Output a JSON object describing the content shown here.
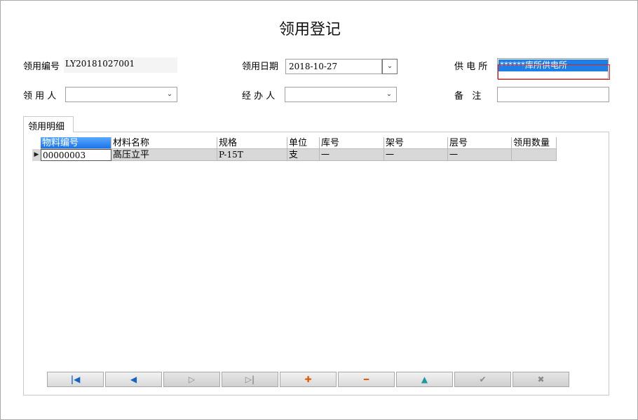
{
  "window": {
    "title": "领用登记"
  },
  "form": {
    "requisition_no_label": "领用编号",
    "requisition_no_value": "LY20181027001",
    "requisition_date_label": "领用日期",
    "requisition_date_value": "2018-10-27",
    "supply_station_label": "供 电 所",
    "supply_station_value": "******库所供电所",
    "requester_label": "领 用 人",
    "requester_value": "",
    "handler_label": "经 办 人",
    "handler_value": "",
    "remarks_label": "备   注",
    "remarks_value": ""
  },
  "tab": {
    "label": "领用明细"
  },
  "grid": {
    "columns": [
      "物料编号",
      "材料名称",
      "规格",
      "单位",
      "库号",
      "架号",
      "层号",
      "领用数量"
    ],
    "rows": [
      [
        "00000003",
        "高压立平",
        "P-15T",
        "支",
        "一",
        "一",
        "一",
        ""
      ]
    ]
  },
  "navigator": {
    "buttons": [
      {
        "name": "first-record-button",
        "glyph": "|◀",
        "color": "#1565c0",
        "enabled": true
      },
      {
        "name": "prev-record-button",
        "glyph": "◀",
        "color": "#1565c0",
        "enabled": true
      },
      {
        "name": "next-record-button",
        "glyph": "▷",
        "color": "#888888",
        "enabled": false
      },
      {
        "name": "last-record-button",
        "glyph": "▷|",
        "color": "#888888",
        "enabled": false
      },
      {
        "name": "insert-record-button",
        "glyph": "✚",
        "color": "#e05a00",
        "enabled": true
      },
      {
        "name": "delete-record-button",
        "glyph": "━",
        "color": "#e05a00",
        "enabled": true
      },
      {
        "name": "edit-record-button",
        "glyph": "▲",
        "color": "#1a9aa0",
        "enabled": true
      },
      {
        "name": "post-record-button",
        "glyph": "✔",
        "color": "#8a8a8a",
        "enabled": false
      },
      {
        "name": "cancel-record-button",
        "glyph": "✖",
        "color": "#8a8a8a",
        "enabled": false
      }
    ]
  }
}
